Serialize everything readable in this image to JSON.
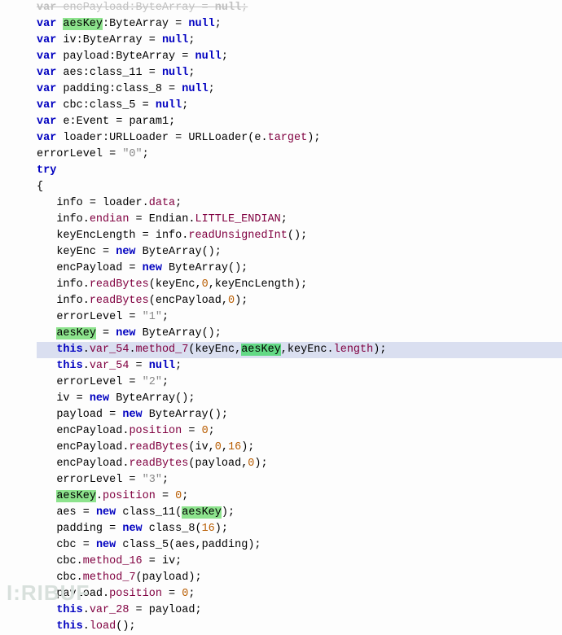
{
  "watermark": "I:RIBUF",
  "lines": [
    {
      "indent": 0,
      "dim": true,
      "tokens": [
        [
          "kw",
          "var "
        ],
        [
          "id",
          "encPayload"
        ],
        [
          "punct",
          ":"
        ],
        [
          "type",
          "ByteArray"
        ],
        [
          "op",
          " = "
        ],
        [
          "kw",
          "null"
        ],
        [
          "punct",
          ";"
        ]
      ]
    },
    {
      "indent": 0,
      "tokens": [
        [
          "kw",
          "var "
        ],
        [
          "hl",
          "aesKey"
        ],
        [
          "punct",
          ":"
        ],
        [
          "type",
          "ByteArray"
        ],
        [
          "op",
          " = "
        ],
        [
          "kw",
          "null"
        ],
        [
          "punct",
          ";"
        ]
      ]
    },
    {
      "indent": 0,
      "tokens": [
        [
          "kw",
          "var "
        ],
        [
          "id",
          "iv"
        ],
        [
          "punct",
          ":"
        ],
        [
          "type",
          "ByteArray"
        ],
        [
          "op",
          " = "
        ],
        [
          "kw",
          "null"
        ],
        [
          "punct",
          ";"
        ]
      ]
    },
    {
      "indent": 0,
      "tokens": [
        [
          "kw",
          "var "
        ],
        [
          "id",
          "payload"
        ],
        [
          "punct",
          ":"
        ],
        [
          "type",
          "ByteArray"
        ],
        [
          "op",
          " = "
        ],
        [
          "kw",
          "null"
        ],
        [
          "punct",
          ";"
        ]
      ]
    },
    {
      "indent": 0,
      "tokens": [
        [
          "kw",
          "var "
        ],
        [
          "id",
          "aes"
        ],
        [
          "punct",
          ":"
        ],
        [
          "type",
          "class_11"
        ],
        [
          "op",
          " = "
        ],
        [
          "kw",
          "null"
        ],
        [
          "punct",
          ";"
        ]
      ]
    },
    {
      "indent": 0,
      "tokens": [
        [
          "kw",
          "var "
        ],
        [
          "id",
          "padding"
        ],
        [
          "punct",
          ":"
        ],
        [
          "type",
          "class_8"
        ],
        [
          "op",
          " = "
        ],
        [
          "kw",
          "null"
        ],
        [
          "punct",
          ";"
        ]
      ]
    },
    {
      "indent": 0,
      "tokens": [
        [
          "kw",
          "var "
        ],
        [
          "id",
          "cbc"
        ],
        [
          "punct",
          ":"
        ],
        [
          "type",
          "class_5"
        ],
        [
          "op",
          " = "
        ],
        [
          "kw",
          "null"
        ],
        [
          "punct",
          ";"
        ]
      ]
    },
    {
      "indent": 0,
      "tokens": [
        [
          "kw",
          "var "
        ],
        [
          "id",
          "e"
        ],
        [
          "punct",
          ":"
        ],
        [
          "type",
          "Event"
        ],
        [
          "op",
          " = "
        ],
        [
          "id",
          "param1"
        ],
        [
          "punct",
          ";"
        ]
      ]
    },
    {
      "indent": 0,
      "tokens": [
        [
          "kw",
          "var "
        ],
        [
          "id",
          "loader"
        ],
        [
          "punct",
          ":"
        ],
        [
          "type",
          "URLLoader"
        ],
        [
          "op",
          " = "
        ],
        [
          "id",
          "URLLoader"
        ],
        [
          "punct",
          "("
        ],
        [
          "id",
          "e"
        ],
        [
          "punct",
          "."
        ],
        [
          "prop",
          "target"
        ],
        [
          "punct",
          ");"
        ]
      ]
    },
    {
      "indent": 0,
      "tokens": [
        [
          "id",
          "errorLevel"
        ],
        [
          "op",
          " = "
        ],
        [
          "str",
          "\"0\""
        ],
        [
          "punct",
          ";"
        ]
      ]
    },
    {
      "indent": 0,
      "tokens": [
        [
          "kw",
          "try"
        ]
      ]
    },
    {
      "indent": 0,
      "tokens": [
        [
          "punct",
          "{"
        ]
      ]
    },
    {
      "indent": 1,
      "tokens": [
        [
          "id",
          "info"
        ],
        [
          "op",
          " = "
        ],
        [
          "id",
          "loader"
        ],
        [
          "punct",
          "."
        ],
        [
          "prop",
          "data"
        ],
        [
          "punct",
          ";"
        ]
      ]
    },
    {
      "indent": 1,
      "tokens": [
        [
          "id",
          "info"
        ],
        [
          "punct",
          "."
        ],
        [
          "prop",
          "endian"
        ],
        [
          "op",
          " = "
        ],
        [
          "id",
          "Endian"
        ],
        [
          "punct",
          "."
        ],
        [
          "prop",
          "LITTLE_ENDIAN"
        ],
        [
          "punct",
          ";"
        ]
      ]
    },
    {
      "indent": 1,
      "tokens": [
        [
          "id",
          "keyEncLength"
        ],
        [
          "op",
          " = "
        ],
        [
          "id",
          "info"
        ],
        [
          "punct",
          "."
        ],
        [
          "prop",
          "readUnsignedInt"
        ],
        [
          "punct",
          "();"
        ]
      ]
    },
    {
      "indent": 1,
      "tokens": [
        [
          "id",
          "keyEnc"
        ],
        [
          "op",
          " = "
        ],
        [
          "kw",
          "new "
        ],
        [
          "id",
          "ByteArray"
        ],
        [
          "punct",
          "();"
        ]
      ]
    },
    {
      "indent": 1,
      "tokens": [
        [
          "id",
          "encPayload"
        ],
        [
          "op",
          " = "
        ],
        [
          "kw",
          "new "
        ],
        [
          "id",
          "ByteArray"
        ],
        [
          "punct",
          "();"
        ]
      ]
    },
    {
      "indent": 1,
      "tokens": [
        [
          "id",
          "info"
        ],
        [
          "punct",
          "."
        ],
        [
          "prop",
          "readBytes"
        ],
        [
          "punct",
          "("
        ],
        [
          "id",
          "keyEnc"
        ],
        [
          "punct",
          ","
        ],
        [
          "num",
          "0"
        ],
        [
          "punct",
          ","
        ],
        [
          "id",
          "keyEncLength"
        ],
        [
          "punct",
          ");"
        ]
      ]
    },
    {
      "indent": 1,
      "tokens": [
        [
          "id",
          "info"
        ],
        [
          "punct",
          "."
        ],
        [
          "prop",
          "readBytes"
        ],
        [
          "punct",
          "("
        ],
        [
          "id",
          "encPayload"
        ],
        [
          "punct",
          ","
        ],
        [
          "num",
          "0"
        ],
        [
          "punct",
          ");"
        ]
      ]
    },
    {
      "indent": 1,
      "tokens": [
        [
          "id",
          "errorLevel"
        ],
        [
          "op",
          " = "
        ],
        [
          "str",
          "\"1\""
        ],
        [
          "punct",
          ";"
        ]
      ]
    },
    {
      "indent": 1,
      "tokens": [
        [
          "hl",
          "aesKey"
        ],
        [
          "op",
          " = "
        ],
        [
          "kw",
          "new "
        ],
        [
          "id",
          "ByteArray"
        ],
        [
          "punct",
          "();"
        ]
      ]
    },
    {
      "indent": 1,
      "highlighted": true,
      "tokens": [
        [
          "kw",
          "this"
        ],
        [
          "punct",
          "."
        ],
        [
          "prop",
          "var_54"
        ],
        [
          "punct",
          "."
        ],
        [
          "prop",
          "method_7"
        ],
        [
          "punct",
          "("
        ],
        [
          "id",
          "keyEnc"
        ],
        [
          "punct",
          ","
        ],
        [
          "hl-caret",
          "aesKey"
        ],
        [
          "punct",
          ","
        ],
        [
          "id",
          "keyEnc"
        ],
        [
          "punct",
          "."
        ],
        [
          "prop",
          "length"
        ],
        [
          "punct",
          ");"
        ]
      ]
    },
    {
      "indent": 1,
      "tokens": [
        [
          "kw",
          "this"
        ],
        [
          "punct",
          "."
        ],
        [
          "prop",
          "var_54"
        ],
        [
          "op",
          " = "
        ],
        [
          "kw",
          "null"
        ],
        [
          "punct",
          ";"
        ]
      ]
    },
    {
      "indent": 1,
      "tokens": [
        [
          "id",
          "errorLevel"
        ],
        [
          "op",
          " = "
        ],
        [
          "str",
          "\"2\""
        ],
        [
          "punct",
          ";"
        ]
      ]
    },
    {
      "indent": 1,
      "tokens": [
        [
          "id",
          "iv"
        ],
        [
          "op",
          " = "
        ],
        [
          "kw",
          "new "
        ],
        [
          "id",
          "ByteArray"
        ],
        [
          "punct",
          "();"
        ]
      ]
    },
    {
      "indent": 1,
      "tokens": [
        [
          "id",
          "payload"
        ],
        [
          "op",
          " = "
        ],
        [
          "kw",
          "new "
        ],
        [
          "id",
          "ByteArray"
        ],
        [
          "punct",
          "();"
        ]
      ]
    },
    {
      "indent": 1,
      "tokens": [
        [
          "id",
          "encPayload"
        ],
        [
          "punct",
          "."
        ],
        [
          "prop",
          "position"
        ],
        [
          "op",
          " = "
        ],
        [
          "num",
          "0"
        ],
        [
          "punct",
          ";"
        ]
      ]
    },
    {
      "indent": 1,
      "tokens": [
        [
          "id",
          "encPayload"
        ],
        [
          "punct",
          "."
        ],
        [
          "prop",
          "readBytes"
        ],
        [
          "punct",
          "("
        ],
        [
          "id",
          "iv"
        ],
        [
          "punct",
          ","
        ],
        [
          "num",
          "0"
        ],
        [
          "punct",
          ","
        ],
        [
          "num",
          "16"
        ],
        [
          "punct",
          ");"
        ]
      ]
    },
    {
      "indent": 1,
      "tokens": [
        [
          "id",
          "encPayload"
        ],
        [
          "punct",
          "."
        ],
        [
          "prop",
          "readBytes"
        ],
        [
          "punct",
          "("
        ],
        [
          "id",
          "payload"
        ],
        [
          "punct",
          ","
        ],
        [
          "num",
          "0"
        ],
        [
          "punct",
          ");"
        ]
      ]
    },
    {
      "indent": 1,
      "tokens": [
        [
          "id",
          "errorLevel"
        ],
        [
          "op",
          " = "
        ],
        [
          "str",
          "\"3\""
        ],
        [
          "punct",
          ";"
        ]
      ]
    },
    {
      "indent": 1,
      "tokens": [
        [
          "hl",
          "aesKey"
        ],
        [
          "punct",
          "."
        ],
        [
          "prop",
          "position"
        ],
        [
          "op",
          " = "
        ],
        [
          "num",
          "0"
        ],
        [
          "punct",
          ";"
        ]
      ]
    },
    {
      "indent": 1,
      "tokens": [
        [
          "id",
          "aes"
        ],
        [
          "op",
          " = "
        ],
        [
          "kw",
          "new "
        ],
        [
          "id",
          "class_11"
        ],
        [
          "punct",
          "("
        ],
        [
          "hl",
          "aesKey"
        ],
        [
          "punct",
          ");"
        ]
      ]
    },
    {
      "indent": 1,
      "tokens": [
        [
          "id",
          "padding"
        ],
        [
          "op",
          " = "
        ],
        [
          "kw",
          "new "
        ],
        [
          "id",
          "class_8"
        ],
        [
          "punct",
          "("
        ],
        [
          "num",
          "16"
        ],
        [
          "punct",
          ");"
        ]
      ]
    },
    {
      "indent": 1,
      "tokens": [
        [
          "id",
          "cbc"
        ],
        [
          "op",
          " = "
        ],
        [
          "kw",
          "new "
        ],
        [
          "id",
          "class_5"
        ],
        [
          "punct",
          "("
        ],
        [
          "id",
          "aes"
        ],
        [
          "punct",
          ","
        ],
        [
          "id",
          "padding"
        ],
        [
          "punct",
          ");"
        ]
      ]
    },
    {
      "indent": 1,
      "tokens": [
        [
          "id",
          "cbc"
        ],
        [
          "punct",
          "."
        ],
        [
          "prop",
          "method_16"
        ],
        [
          "op",
          " = "
        ],
        [
          "id",
          "iv"
        ],
        [
          "punct",
          ";"
        ]
      ]
    },
    {
      "indent": 1,
      "tokens": [
        [
          "id",
          "cbc"
        ],
        [
          "punct",
          "."
        ],
        [
          "prop",
          "method_7"
        ],
        [
          "punct",
          "("
        ],
        [
          "id",
          "payload"
        ],
        [
          "punct",
          ");"
        ]
      ]
    },
    {
      "indent": 1,
      "tokens": [
        [
          "id",
          "payload"
        ],
        [
          "punct",
          "."
        ],
        [
          "prop",
          "position"
        ],
        [
          "op",
          " = "
        ],
        [
          "num",
          "0"
        ],
        [
          "punct",
          ";"
        ]
      ]
    },
    {
      "indent": 1,
      "tokens": [
        [
          "kw",
          "this"
        ],
        [
          "punct",
          "."
        ],
        [
          "prop",
          "var_28"
        ],
        [
          "op",
          " = "
        ],
        [
          "id",
          "payload"
        ],
        [
          "punct",
          ";"
        ]
      ]
    },
    {
      "indent": 1,
      "tokens": [
        [
          "kw",
          "this"
        ],
        [
          "punct",
          "."
        ],
        [
          "prop",
          "load"
        ],
        [
          "punct",
          "();"
        ]
      ]
    }
  ]
}
